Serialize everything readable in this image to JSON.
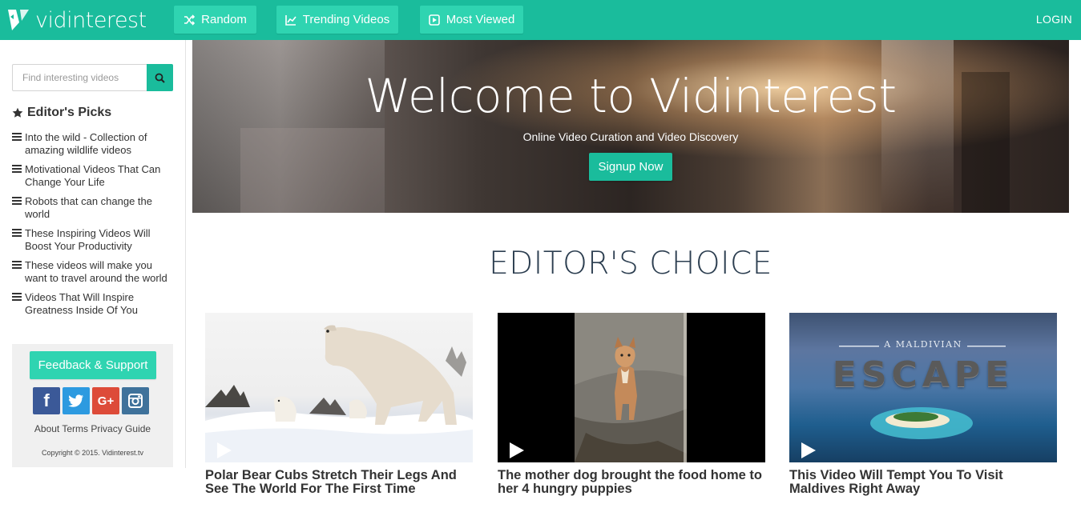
{
  "brand": {
    "name": "vidinterest"
  },
  "nav": {
    "random": "Random",
    "trending": "Trending Videos",
    "most_viewed": "Most Viewed",
    "login": "LOGIN"
  },
  "sidebar": {
    "search_placeholder": "Find interesting videos",
    "picks_title": "Editor's Picks",
    "picks": [
      "Into the wild - Collection of amazing wildlife videos",
      "Motivational Videos That Can Change Your Life",
      "Robots that can change the world",
      "These Inspiring Videos Will Boost Your Productivity",
      "These videos will make you want to travel around the world",
      "Videos That Will Inspire Greatness Inside Of You"
    ],
    "feedback": "Feedback & Support",
    "social": {
      "facebook": "f",
      "google": "G+"
    },
    "footer_links": "About Terms Privacy Guide",
    "copyright": "Copyright © 2015. Vidinterest.tv"
  },
  "hero": {
    "title": "Welcome to Vidinterest",
    "subtitle": "Online Video Curation and Video Discovery",
    "cta": "Signup Now"
  },
  "editors_choice": {
    "title": "EDITOR'S CHOICE",
    "cards": [
      {
        "title": "Polar Bear Cubs Stretch Their Legs And See The World For The First Time"
      },
      {
        "title": "The mother dog brought the food home to her 4 hungry puppies"
      },
      {
        "title": "This Video Will Tempt You To Visit Maldives Right Away",
        "thumb_top": "A MALDIVIAN",
        "thumb_main": "ESCAPE"
      }
    ]
  },
  "colors": {
    "accent": "#1abc9c",
    "button": "#2fd4b1",
    "heading": "#2c3e50"
  }
}
